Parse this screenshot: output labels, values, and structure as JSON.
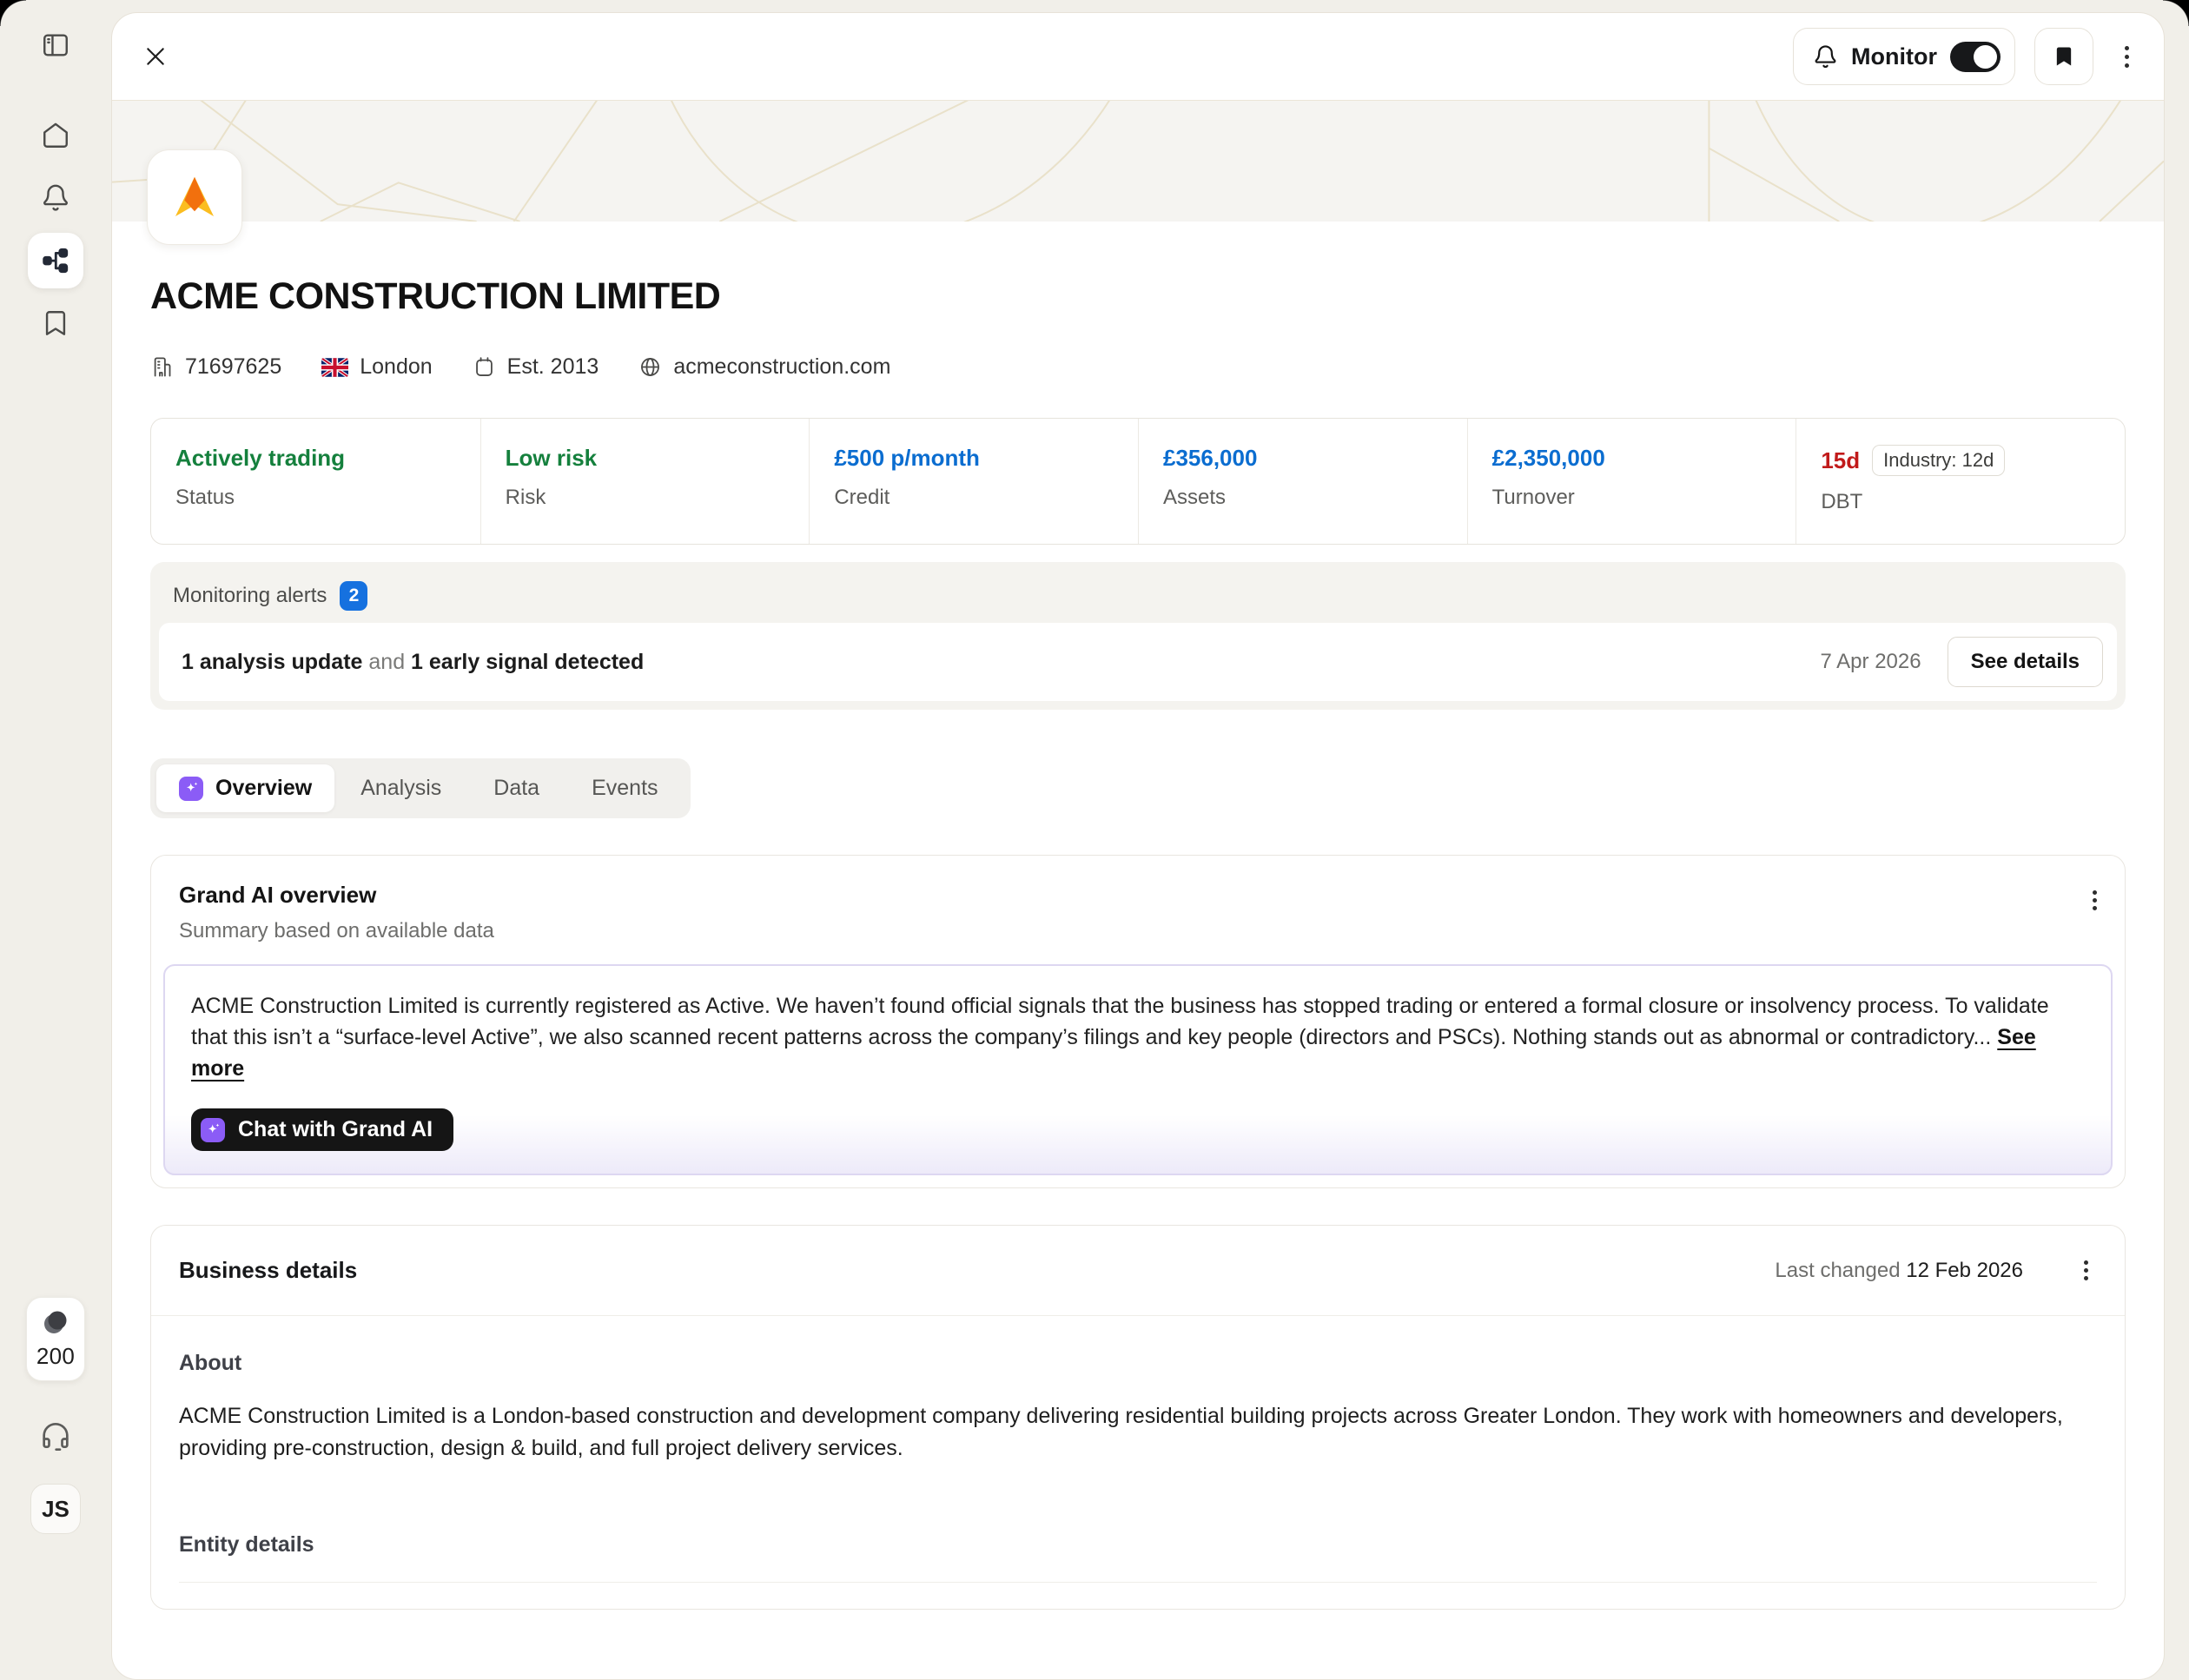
{
  "colors": {
    "green": "#15803d",
    "blue": "#0b6dd0",
    "red": "#c11a1a",
    "badge_blue": "#1671df",
    "purple": "#8b5cf6"
  },
  "sidebar": {
    "credits": "200",
    "avatar_initials": "JS"
  },
  "topbar": {
    "monitor_label": "Monitor"
  },
  "company": {
    "name": "ACME CONSTRUCTION LIMITED",
    "registration_number": "71697625",
    "location": "London",
    "established": "Est. 2013",
    "website": "acmeconstruction.com"
  },
  "stats": {
    "cards": [
      {
        "value": "Actively trading",
        "label": "Status",
        "value_color": "#15803d"
      },
      {
        "value": "Low risk",
        "label": "Risk",
        "value_color": "#15803d"
      },
      {
        "value": "£500 p/month",
        "label": "Credit",
        "value_color": "#0b6dd0"
      },
      {
        "value": "£356,000",
        "label": "Assets",
        "value_color": "#0b6dd0"
      },
      {
        "value": "£2,350,000",
        "label": "Turnover",
        "value_color": "#0b6dd0"
      },
      {
        "value": "15d",
        "label": "DBT",
        "value_color": "#c11a1a",
        "badge": "Industry: 12d"
      }
    ]
  },
  "monitoring": {
    "title": "Monitoring alerts",
    "count": "2",
    "summary_bold_1": "1 analysis update",
    "summary_connector": " and ",
    "summary_bold_2": "1 early signal detected",
    "date": "7 Apr 2026",
    "details_button": "See details"
  },
  "tabs": {
    "overview": "Overview",
    "analysis": "Analysis",
    "data": "Data",
    "events": "Events"
  },
  "ai_overview": {
    "title": "Grand AI overview",
    "subtitle": "Summary based on available data",
    "summary": "ACME Construction Limited is currently registered as Active. We haven’t found official signals that the business has stopped trading or entered a formal closure or insolvency process. To validate that this isn’t a “surface-level Active”, we also scanned recent patterns across the company’s filings and key people (directors and PSCs). Nothing stands out as abnormal or contradictory... ",
    "see_more": "See more",
    "chat_button": "Chat with Grand AI"
  },
  "business_details": {
    "title": "Business details",
    "last_changed_label": "Last changed ",
    "last_changed_date": "12 Feb 2026",
    "about_heading": "About",
    "about_text": "ACME Construction Limited is a London-based construction and development company delivering residential building projects across Greater London. They work with homeowners and developers, providing pre-construction, design & build, and full project delivery services.",
    "entity_heading": "Entity details"
  }
}
